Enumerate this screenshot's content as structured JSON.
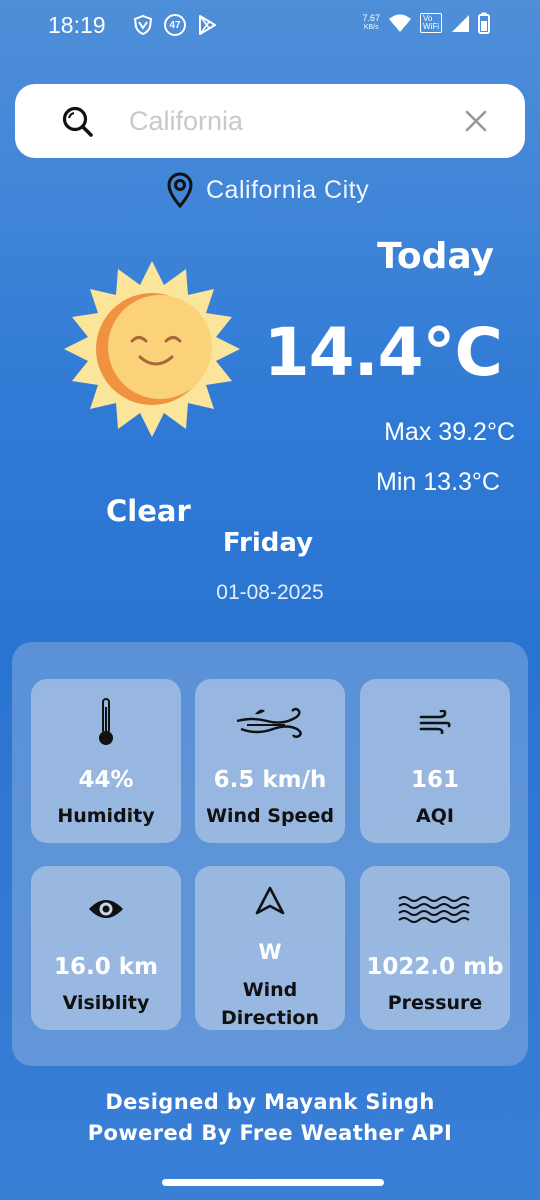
{
  "status_bar": {
    "time": "18:19",
    "notification_badge": "47",
    "net_speed_value": "7.67",
    "net_speed_unit": "KB/s",
    "vowifi_line1": "Vo",
    "vowifi_line2": "WiFi"
  },
  "search": {
    "placeholder": "California",
    "value": ""
  },
  "location": {
    "name": "California City"
  },
  "weather": {
    "today_label": "Today",
    "temperature": "14.4°C",
    "max": "Max 39.2°C",
    "min": "Min 13.3°C",
    "condition": "Clear",
    "icon": "sun-icon",
    "day": "Friday",
    "date": "01-08-2025"
  },
  "details": [
    {
      "icon": "thermometer-icon",
      "value": "44%",
      "label": "Humidity"
    },
    {
      "icon": "wind-icon",
      "value": "6.5 km/h",
      "label": "Wind Speed"
    },
    {
      "icon": "air-quality-icon",
      "value": "161",
      "label": "AQI"
    },
    {
      "icon": "eye-icon",
      "value": "16.0 km",
      "label": "Visiblity"
    },
    {
      "icon": "navigation-arrow-icon",
      "value": "W",
      "label_line1": "Wind",
      "label_line2": "Direction"
    },
    {
      "icon": "waves-icon",
      "value": "1022.0 mb",
      "label": "Pressure"
    }
  ],
  "footer": {
    "designed_by": "Designed by Mayank Singh",
    "powered_by": "Powered By Free Weather API"
  },
  "colors": {
    "background_top": "#4f8fd9",
    "background_mid": "#2a74d1",
    "sun_body": "#fbd27a",
    "sun_rays": "#fbe59a",
    "sun_shadow": "#f0923f"
  }
}
